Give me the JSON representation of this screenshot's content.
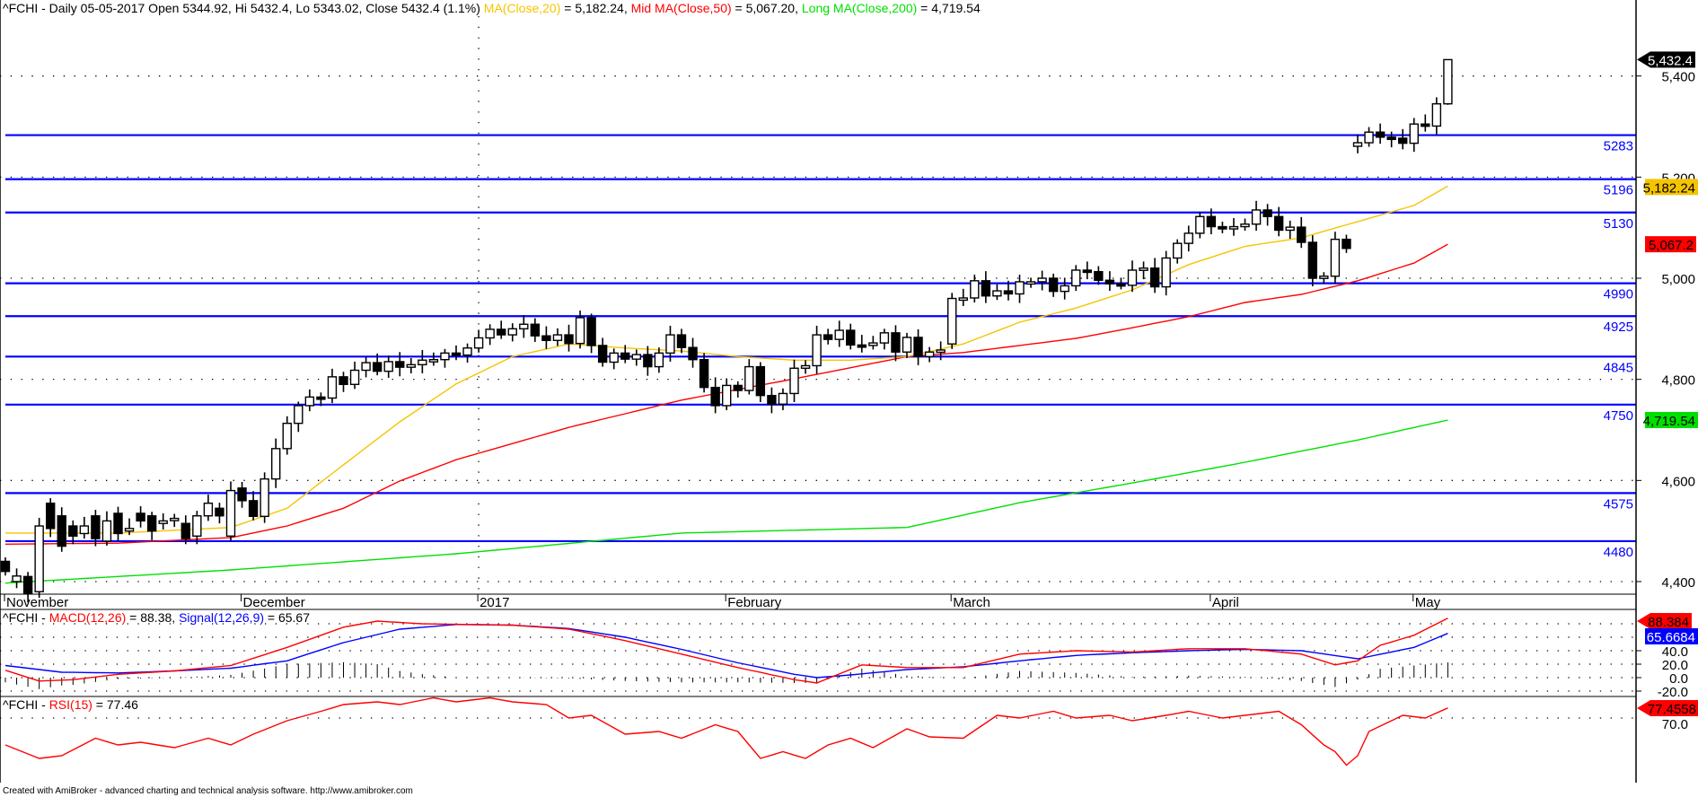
{
  "title": {
    "main": "^FCHI - Daily 05-05-2017 Open 5344.92, Hi 5432.4, Lo 5343.02, Close 5432.4 (1.1%) ",
    "ma20_label": "MA(Close,20)",
    "ma20_value": " = 5,182.24, ",
    "ma50_label": "Mid MA(Close,50)",
    "ma50_value": " = 5,067.20, ",
    "ma200_label": "Long MA(Close,200)",
    "ma200_value": " = 4,719.54"
  },
  "macd_title": {
    "prefix": "^FCHI - ",
    "macd_label": "MACD(12,26)",
    "macd_value": " = 88.38, ",
    "signal_label": "Signal(12,26,9)",
    "signal_value": " = 65.67"
  },
  "rsi_title": {
    "prefix": "^FCHI - ",
    "rsi_label": "RSI(15)",
    "rsi_value": " = 77.46"
  },
  "footer": "Created with AmiBroker - advanced charting and technical analysis software. http://www.amibroker.com",
  "colors": {
    "ma20": "#f5c400",
    "ma50": "#ff0000",
    "ma200": "#00e000",
    "levels": "#0000ff",
    "macd": "#ff0000",
    "signal": "#0000ff",
    "rsi": "#ff0000"
  },
  "price_axis": [
    "5,400",
    "5,200",
    "5,000",
    "4,800",
    "4,600",
    "4,400"
  ],
  "price_axis_values": [
    5400,
    5200,
    5000,
    4800,
    4600,
    4400
  ],
  "macd_axis": [
    "40.0",
    "20.0",
    "0.0",
    "-20.0"
  ],
  "macd_axis_values": [
    40,
    20,
    0,
    -20
  ],
  "rsi_axis": [
    "70.0"
  ],
  "rsi_axis_values": [
    70
  ],
  "months": [
    {
      "label": "November",
      "bar": 0
    },
    {
      "label": "December",
      "bar": 21
    },
    {
      "label": "2017",
      "bar": 42
    },
    {
      "label": "February",
      "bar": 64
    },
    {
      "label": "March",
      "bar": 84
    },
    {
      "label": "April",
      "bar": 107
    },
    {
      "label": "May",
      "bar": 125
    }
  ],
  "levels": [
    {
      "label": "5283",
      "value": 5283
    },
    {
      "label": "5196",
      "value": 5196
    },
    {
      "label": "5130",
      "value": 5130
    },
    {
      "label": "4990",
      "value": 4990
    },
    {
      "label": "4925",
      "value": 4925
    },
    {
      "label": "4845",
      "value": 4845
    },
    {
      "label": "4750",
      "value": 4750
    },
    {
      "label": "4575",
      "value": 4575
    },
    {
      "label": "4480",
      "value": 4480
    }
  ],
  "tags": {
    "close": {
      "label": "5,432.4",
      "value": 5432.4
    },
    "ma20": {
      "label": "5,182.24",
      "value": 5182.24
    },
    "ma50": {
      "label": "5,067.2",
      "value": 5067.2
    },
    "ma200": {
      "label": "4,719.54",
      "value": 4719.54
    },
    "macd": {
      "label": "88.384",
      "value": 88.384
    },
    "signal": {
      "label": "65.6684",
      "value": 65.6684
    },
    "rsi": {
      "label": "77.4558",
      "value": 77.4558
    }
  },
  "chart_data": {
    "type": "candlestick",
    "symbol": "^FCHI",
    "period": "Daily",
    "ylim": [
      4350,
      5480
    ],
    "close": [
      4420,
      4411,
      4377,
      4510,
      4505,
      4470,
      4490,
      4510,
      4485,
      4520,
      4495,
      4505,
      4520,
      4500,
      4520,
      4525,
      4485,
      4530,
      4555,
      4530,
      4580,
      4560,
      4529,
      4603,
      4663,
      4713,
      4748,
      4765,
      4763,
      4805,
      4790,
      4818,
      4833,
      4816,
      4835,
      4824,
      4829,
      4838,
      4839,
      4852,
      4848,
      4862,
      4882,
      4899,
      4888,
      4900,
      4909,
      4886,
      4877,
      4888,
      4871,
      4922,
      4867,
      4834,
      4852,
      4840,
      4849,
      4825,
      4852,
      4888,
      4863,
      4839,
      4784,
      4748,
      4788,
      4778,
      4825,
      4768,
      4751,
      4772,
      4822,
      4827,
      4888,
      4879,
      4897,
      4868,
      4867,
      4872,
      4892,
      4854,
      4883,
      4845,
      4854,
      4858,
      4960,
      4961,
      4995,
      4965,
      4975,
      4969,
      4993,
      4993,
      5000,
      4974,
      4985,
      5016,
      5013,
      4996,
      4989,
      4986,
      5016,
      5020,
      4983,
      5040,
      5069,
      5089,
      5122,
      5102,
      5098,
      5102,
      5107,
      5135,
      5122,
      5095,
      5101,
      5071,
      5000,
      5004,
      5077,
      5059,
      5268,
      5289,
      5279,
      5277,
      5267,
      5305,
      5301,
      5344.92,
      5432.4
    ],
    "open": [
      4440,
      4400,
      4410,
      4380,
      4555,
      4530,
      4510,
      4495,
      4530,
      4480,
      4535,
      4500,
      4535,
      4530,
      4515,
      4525,
      4515,
      4490,
      4530,
      4545,
      4490,
      4585,
      4560,
      4529,
      4603,
      4663,
      4713,
      4748,
      4765,
      4763,
      4805,
      4790,
      4818,
      4833,
      4816,
      4835,
      4824,
      4829,
      4838,
      4839,
      4852,
      4848,
      4862,
      4882,
      4899,
      4888,
      4900,
      4909,
      4886,
      4877,
      4888,
      4871,
      4922,
      4867,
      4834,
      4852,
      4840,
      4849,
      4825,
      4852,
      4888,
      4863,
      4839,
      4784,
      4748,
      4788,
      4778,
      4825,
      4768,
      4751,
      4772,
      4822,
      4827,
      4888,
      4879,
      4897,
      4868,
      4867,
      4872,
      4892,
      4854,
      4883,
      4845,
      4854,
      4870,
      4960,
      4961,
      4995,
      4965,
      4975,
      4969,
      4993,
      4993,
      5000,
      4974,
      4985,
      5016,
      5013,
      4996,
      4989,
      4986,
      5016,
      5020,
      4983,
      5040,
      5069,
      5089,
      5122,
      5102,
      5098,
      5102,
      5107,
      5135,
      5122,
      5095,
      5101,
      5071,
      5000,
      5004,
      5077,
      5261,
      5268,
      5289,
      5279,
      5277,
      5267,
      5305,
      5301,
      5344.92
    ],
    "last_bar": {
      "open": 5344.92,
      "high": 5432.4,
      "low": 5343.02,
      "close": 5432.4
    },
    "ma20_samples": [
      [
        0,
        4496
      ],
      [
        10,
        4496
      ],
      [
        20,
        4507
      ],
      [
        25,
        4545
      ],
      [
        30,
        4631
      ],
      [
        35,
        4716
      ],
      [
        40,
        4791
      ],
      [
        45,
        4845
      ],
      [
        50,
        4870
      ],
      [
        55,
        4862
      ],
      [
        60,
        4856
      ],
      [
        65,
        4845
      ],
      [
        70,
        4838
      ],
      [
        75,
        4838
      ],
      [
        80,
        4845
      ],
      [
        85,
        4870
      ],
      [
        90,
        4913
      ],
      [
        95,
        4941
      ],
      [
        100,
        4977
      ],
      [
        105,
        5027
      ],
      [
        110,
        5063
      ],
      [
        115,
        5080
      ],
      [
        120,
        5112
      ],
      [
        125,
        5144
      ],
      [
        128,
        5182.24
      ]
    ],
    "ma50_samples": [
      [
        0,
        4474
      ],
      [
        10,
        4476
      ],
      [
        20,
        4487
      ],
      [
        25,
        4510
      ],
      [
        30,
        4545
      ],
      [
        35,
        4599
      ],
      [
        40,
        4641
      ],
      [
        45,
        4673
      ],
      [
        50,
        4705
      ],
      [
        55,
        4732
      ],
      [
        60,
        4759
      ],
      [
        65,
        4780
      ],
      [
        70,
        4801
      ],
      [
        75,
        4823
      ],
      [
        80,
        4845
      ],
      [
        85,
        4853
      ],
      [
        90,
        4867
      ],
      [
        95,
        4881
      ],
      [
        100,
        4902
      ],
      [
        105,
        4924
      ],
      [
        110,
        4952
      ],
      [
        115,
        4968
      ],
      [
        120,
        4995
      ],
      [
        125,
        5030
      ],
      [
        128,
        5067.2
      ]
    ],
    "ma200_samples": [
      [
        0,
        4397
      ],
      [
        20,
        4423
      ],
      [
        40,
        4455
      ],
      [
        60,
        4496
      ],
      [
        80,
        4507
      ],
      [
        90,
        4556
      ],
      [
        100,
        4595
      ],
      [
        110,
        4636
      ],
      [
        120,
        4680
      ],
      [
        128,
        4719.54
      ]
    ],
    "macd_samples": [
      [
        0,
        11
      ],
      [
        3,
        -5
      ],
      [
        6,
        -3
      ],
      [
        10,
        5
      ],
      [
        15,
        10
      ],
      [
        20,
        18
      ],
      [
        25,
        45
      ],
      [
        30,
        75
      ],
      [
        33,
        84
      ],
      [
        37,
        80
      ],
      [
        45,
        78
      ],
      [
        50,
        72
      ],
      [
        55,
        55
      ],
      [
        60,
        35
      ],
      [
        65,
        15
      ],
      [
        70,
        -3
      ],
      [
        72,
        -8
      ],
      [
        76,
        19
      ],
      [
        80,
        15
      ],
      [
        85,
        15
      ],
      [
        90,
        35
      ],
      [
        95,
        40
      ],
      [
        100,
        38
      ],
      [
        105,
        43
      ],
      [
        110,
        43
      ],
      [
        115,
        35
      ],
      [
        118,
        19
      ],
      [
        120,
        25
      ],
      [
        122,
        48
      ],
      [
        125,
        63
      ],
      [
        128,
        88.38
      ]
    ],
    "signal_samples": [
      [
        0,
        18
      ],
      [
        5,
        8
      ],
      [
        10,
        7
      ],
      [
        15,
        10
      ],
      [
        20,
        14
      ],
      [
        25,
        25
      ],
      [
        30,
        52
      ],
      [
        35,
        72
      ],
      [
        40,
        79
      ],
      [
        45,
        78
      ],
      [
        50,
        73
      ],
      [
        55,
        60
      ],
      [
        60,
        42
      ],
      [
        65,
        22
      ],
      [
        70,
        5
      ],
      [
        72,
        0
      ],
      [
        75,
        4
      ],
      [
        80,
        12
      ],
      [
        85,
        16
      ],
      [
        90,
        25
      ],
      [
        95,
        33
      ],
      [
        100,
        37
      ],
      [
        105,
        40
      ],
      [
        110,
        42
      ],
      [
        115,
        40
      ],
      [
        120,
        28
      ],
      [
        125,
        45
      ],
      [
        128,
        65.67
      ]
    ],
    "rsi_samples": [
      [
        0,
        50
      ],
      [
        3,
        40
      ],
      [
        5,
        42
      ],
      [
        8,
        55
      ],
      [
        10,
        50
      ],
      [
        12,
        52
      ],
      [
        15,
        48
      ],
      [
        18,
        55
      ],
      [
        20,
        50
      ],
      [
        22,
        58
      ],
      [
        25,
        68
      ],
      [
        28,
        75
      ],
      [
        30,
        80
      ],
      [
        33,
        82
      ],
      [
        35,
        80
      ],
      [
        38,
        85
      ],
      [
        40,
        82
      ],
      [
        43,
        85
      ],
      [
        45,
        82
      ],
      [
        48,
        80
      ],
      [
        50,
        70
      ],
      [
        52,
        72
      ],
      [
        55,
        58
      ],
      [
        58,
        60
      ],
      [
        60,
        55
      ],
      [
        63,
        65
      ],
      [
        65,
        60
      ],
      [
        67,
        40
      ],
      [
        69,
        45
      ],
      [
        71,
        40
      ],
      [
        73,
        50
      ],
      [
        75,
        55
      ],
      [
        77,
        48
      ],
      [
        80,
        62
      ],
      [
        82,
        56
      ],
      [
        85,
        55
      ],
      [
        88,
        72
      ],
      [
        90,
        70
      ],
      [
        93,
        75
      ],
      [
        95,
        70
      ],
      [
        98,
        72
      ],
      [
        100,
        68
      ],
      [
        103,
        72
      ],
      [
        105,
        75
      ],
      [
        108,
        70
      ],
      [
        110,
        72
      ],
      [
        113,
        75
      ],
      [
        115,
        65
      ],
      [
        117,
        50
      ],
      [
        118,
        45
      ],
      [
        119,
        35
      ],
      [
        120,
        42
      ],
      [
        121,
        60
      ],
      [
        124,
        72
      ],
      [
        126,
        70
      ],
      [
        128,
        77.46
      ]
    ]
  }
}
